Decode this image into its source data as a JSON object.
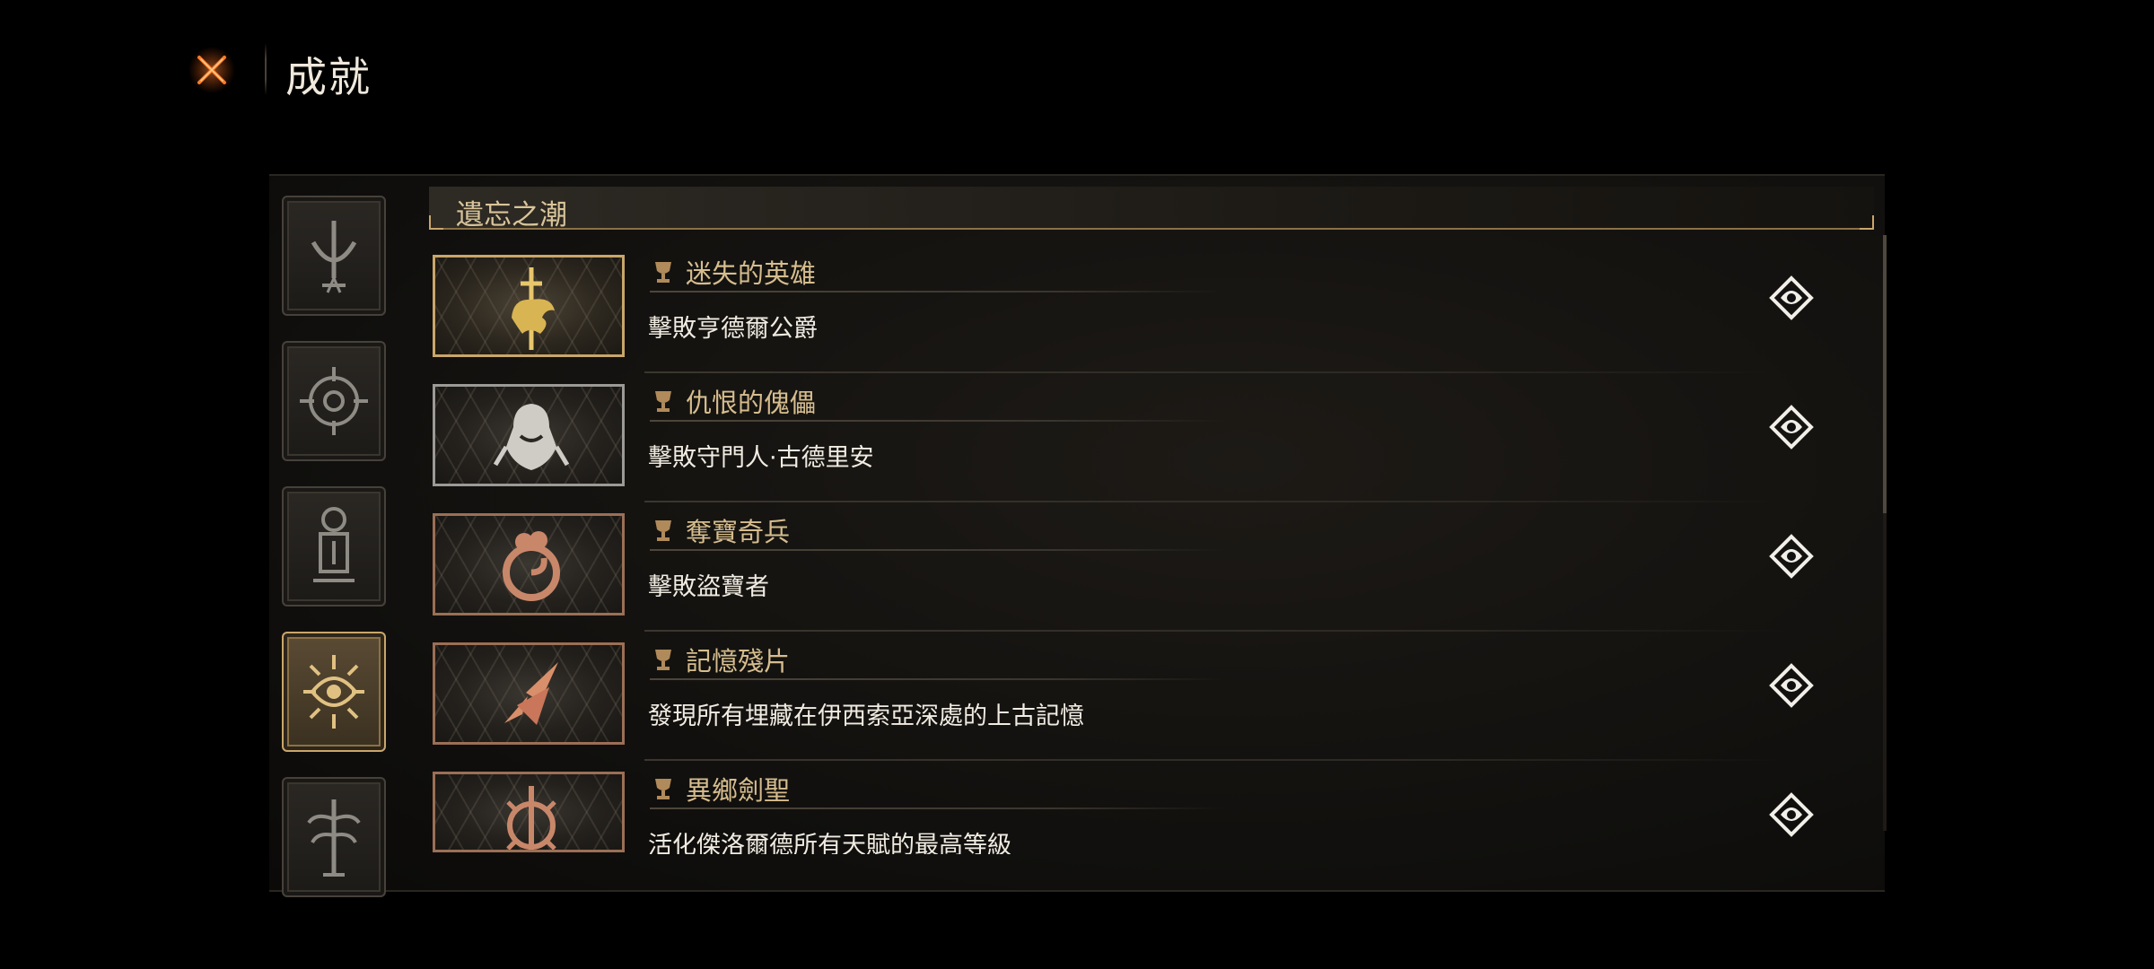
{
  "header": {
    "title": "成就",
    "close_icon": "close-x-icon"
  },
  "sidebar": {
    "categories": [
      {
        "icon": "sword-arch-icon",
        "active": false
      },
      {
        "icon": "compass-eye-icon",
        "active": false
      },
      {
        "icon": "lantern-pillar-icon",
        "active": false
      },
      {
        "icon": "radiant-eye-icon",
        "active": true
      },
      {
        "icon": "spire-tree-icon",
        "active": false
      }
    ]
  },
  "section": {
    "title": "遺忘之潮"
  },
  "achievements": [
    {
      "title": "迷失的英雄",
      "description": "擊敗亨德爾公爵",
      "tier": "gold",
      "icon": "golden-beast-sword-icon"
    },
    {
      "title": "仇恨的傀儡",
      "description": "擊敗守門人·古德里安",
      "tier": "silver",
      "icon": "hooded-golem-icon"
    },
    {
      "title": "奪寶奇兵",
      "description": "擊敗盜寶者",
      "tier": "bronze",
      "icon": "coiled-treasure-icon"
    },
    {
      "title": "記憶殘片",
      "description": "發現所有埋藏在伊西索亞深處的上古記憶",
      "tier": "bronze",
      "icon": "shattered-shards-icon"
    },
    {
      "title": "異鄉劍聖",
      "description": "活化傑洛爾德所有天賦的最高等級",
      "tier": "bronze",
      "icon": "sword-sun-icon"
    }
  ],
  "colors": {
    "gold": "#c9a66a",
    "silver": "#9c9a96",
    "bronze": "#9b6f55",
    "accent_text": "#d6bd8e"
  }
}
